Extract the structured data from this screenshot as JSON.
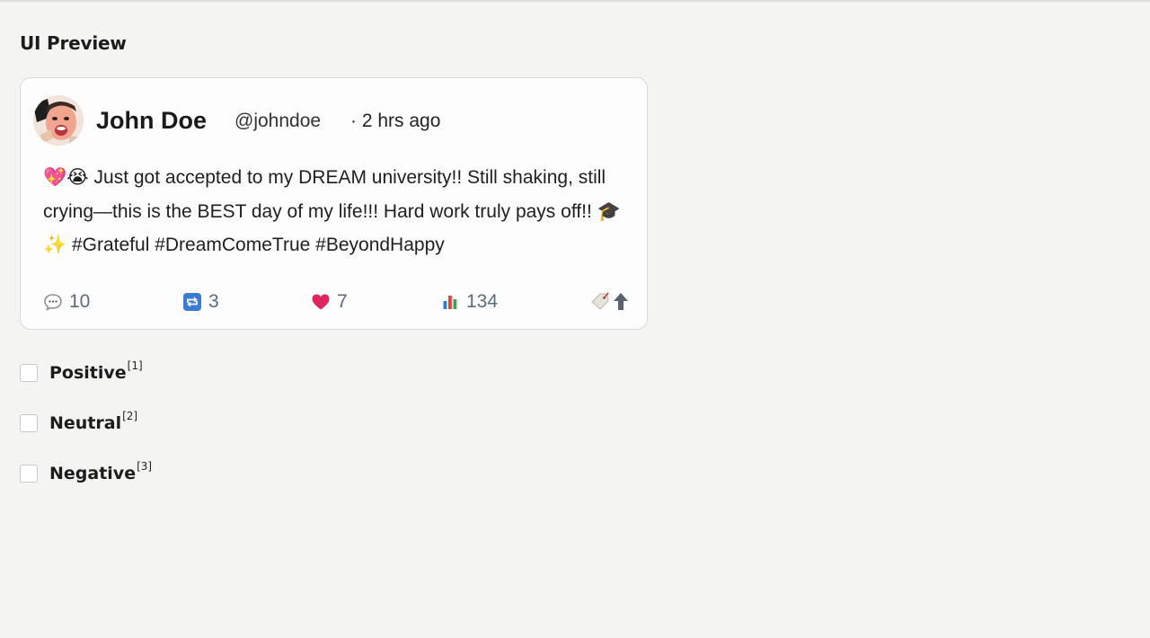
{
  "page": {
    "section_title": "UI Preview"
  },
  "tweet": {
    "display_name": "John Doe",
    "handle": "@johndoe",
    "time": "· 2 hrs ago",
    "body_lead_emoji": "💖😭",
    "body_text": " Just got accepted to my DREAM university!! Still shaking, still crying—this is the BEST day of my life!!! Hard work truly pays off!! ",
    "body_trail_emoji": "🎓✨",
    "hashtags": " #Grateful #DreamComeTrue #BeyondHappy",
    "actions": {
      "comments": "10",
      "retweets": "3",
      "likes": "7",
      "views": "134"
    },
    "icons": {
      "comment": "comment-bubble-icon",
      "retweet": "retweet-icon",
      "like": "heart-icon",
      "views": "bar-chart-icon",
      "share": "share-upload-icon"
    },
    "colors": {
      "heart": "#e0245e",
      "retweet": "#3b7bd4",
      "action_text": "#5b6b7a"
    }
  },
  "options": [
    {
      "label": "Positive",
      "ref": "[1]"
    },
    {
      "label": "Neutral",
      "ref": "[2]"
    },
    {
      "label": "Negative",
      "ref": "[3]"
    }
  ]
}
